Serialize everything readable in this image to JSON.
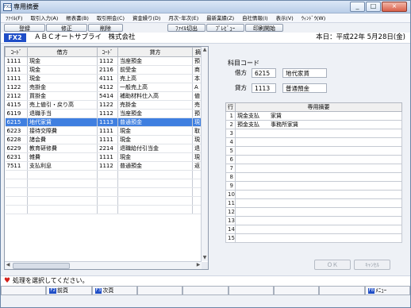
{
  "window": {
    "title": "専用摘要",
    "app_icon": "FX2",
    "controls": [
      "_",
      "□",
      "×"
    ]
  },
  "menu": [
    "ﾌｧｲﾙ(F)",
    "取引入力(A)",
    "帳表書(B)",
    "取引照会(C)",
    "資金繰り(D)",
    "月次･年次(E)",
    "最新業績(Z)",
    "自社情報(I)",
    "表示(V)",
    "ｳｨﾝﾄﾞｳ(W)"
  ],
  "toolbar": {
    "register": "登録",
    "modify": "修正",
    "delete": "削除",
    "file_output": "ﾌｧｲﾙ切出",
    "preview": "ﾌﾟﾚﾋﾞｭｰ",
    "print": "印刷開始"
  },
  "info": {
    "company_code": "FX2",
    "company_name": "ＡＢＣオートサプライ　株式会社",
    "today": "本日：平成22年 5月28日(金)"
  },
  "grid": {
    "headers": [
      "ｺｰﾄﾞ",
      "借方",
      "ｺｰﾄﾞ",
      "貸方",
      "摘"
    ],
    "rows": [
      [
        "1111",
        "現金",
        "1112",
        "当座預金",
        "預"
      ],
      [
        "1111",
        "現金",
        "2116",
        "前受金",
        "商"
      ],
      [
        "1111",
        "現金",
        "4111",
        "売上高",
        "本"
      ],
      [
        "1122",
        "売掛金",
        "4112",
        "一般売上高",
        "A"
      ],
      [
        "2112",
        "買掛金",
        "5414",
        "補助材料仕入高",
        "値"
      ],
      [
        "4115",
        "売上値引・戻り高",
        "1122",
        "売掛金",
        "売"
      ],
      [
        "6119",
        "退職手当",
        "1112",
        "当座預金",
        "預"
      ],
      [
        "6215",
        "地代家賃",
        "1113",
        "普通預金",
        "現"
      ],
      [
        "6223",
        "接待交際費",
        "1111",
        "現金",
        "取"
      ],
      [
        "6228",
        "諸会費",
        "1111",
        "現金",
        "現"
      ],
      [
        "6229",
        "教育研修費",
        "2214",
        "退職給付引当金",
        "退"
      ],
      [
        "6231",
        "雑費",
        "1111",
        "現金",
        "現"
      ],
      [
        "7511",
        "支払利息",
        "1112",
        "普通預金",
        "返"
      ]
    ],
    "selected_index": 7
  },
  "detail": {
    "section_title": "科目コード",
    "debit_label": "借方",
    "debit_code": "6215",
    "debit_name": "地代家賃",
    "credit_label": "貸方",
    "credit_code": "1113",
    "credit_name": "普通預金",
    "memo_headers": [
      "行",
      "専用摘要"
    ],
    "memo_rows": [
      {
        "line": "1",
        "text": "現金支払　　家賃"
      },
      {
        "line": "2",
        "text": "預金支払　　事務所家賃"
      },
      {
        "line": "3",
        "text": ""
      },
      {
        "line": "4",
        "text": ""
      },
      {
        "line": "5",
        "text": ""
      },
      {
        "line": "6",
        "text": ""
      },
      {
        "line": "7",
        "text": ""
      },
      {
        "line": "8",
        "text": ""
      },
      {
        "line": "9",
        "text": ""
      },
      {
        "line": "10",
        "text": ""
      },
      {
        "line": "11",
        "text": ""
      },
      {
        "line": "12",
        "text": ""
      },
      {
        "line": "13",
        "text": ""
      },
      {
        "line": "14",
        "text": ""
      },
      {
        "line": "15",
        "text": ""
      }
    ],
    "ok_label": "ＯＫ",
    "cancel_label": "ｷｬﾝｾﾙ"
  },
  "status": {
    "message": "処理を選択してください。"
  },
  "fkeys": [
    {
      "key": "",
      "label": ""
    },
    {
      "key": "F2",
      "label": "前頁"
    },
    {
      "key": "F3",
      "label": "次頁"
    },
    {
      "key": "",
      "label": ""
    },
    {
      "key": "",
      "label": ""
    },
    {
      "key": "",
      "label": ""
    },
    {
      "key": "",
      "label": ""
    },
    {
      "key": "",
      "label": ""
    },
    {
      "key": "F8",
      "label": "ﾒﾆｭｰ"
    }
  ],
  "colors": {
    "accent": "#1f4ec7",
    "selection": "#3f7fe0",
    "status_icon": "#d4201a"
  },
  "icons": {
    "app": "app-icon",
    "status": "heart-icon"
  }
}
